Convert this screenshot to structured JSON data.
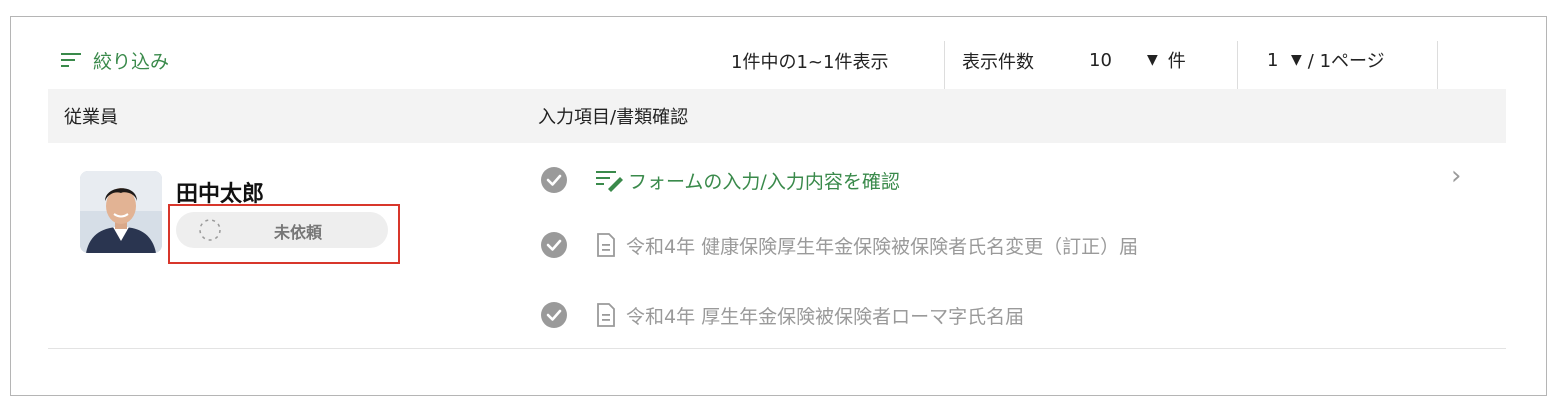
{
  "toolbar": {
    "filter_label": "絞り込み",
    "result_summary": "1件中の1~1件表示",
    "per_page_label": "表示件数",
    "per_page_value": "10",
    "per_page_unit": "件",
    "page_value": "1",
    "page_suffix": "/ 1ページ"
  },
  "table": {
    "columns": [
      "従業員",
      "入力項目/書類確認"
    ],
    "rows": [
      {
        "employee_name": "田中太郎",
        "status": "未依頼",
        "form_link": "フォームの入力/入力内容を確認",
        "documents": [
          "令和4年 健康保険厚生年金保険被保険者氏名変更（訂正）届",
          "令和4年 厚生年金保険被保険者ローマ字氏名届"
        ]
      }
    ]
  },
  "colors": {
    "accent_green": "#3a8a4b",
    "highlight_red": "#d8362b",
    "check_gray": "#9a9a9a"
  },
  "icons": [
    "filter-icon",
    "caret-down-icon",
    "spinner-icon",
    "check-circle-icon",
    "form-edit-icon",
    "document-icon",
    "chevron-right-icon"
  ]
}
